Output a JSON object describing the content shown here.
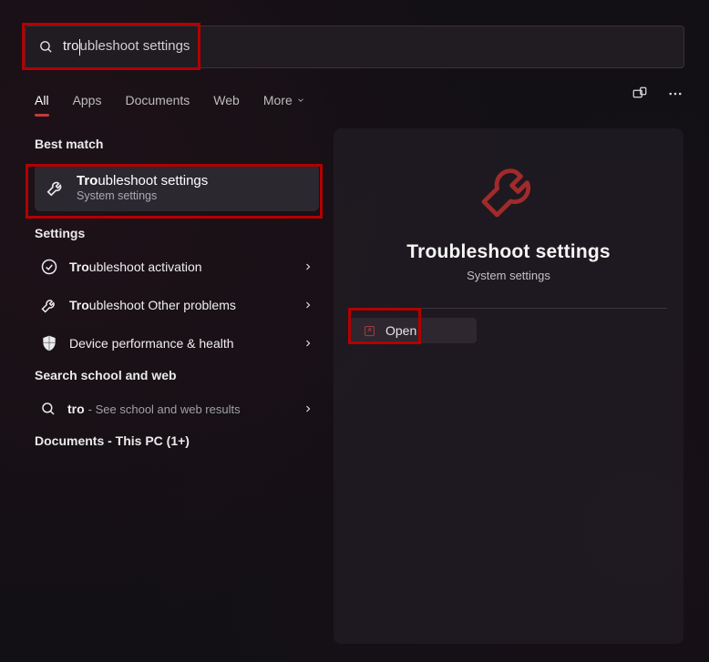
{
  "search": {
    "typed": "tro",
    "completion": "ubleshoot settings"
  },
  "filters": {
    "tabs": [
      "All",
      "Apps",
      "Documents",
      "Web",
      "More"
    ],
    "active_index": 0
  },
  "sections": {
    "best_match_head": "Best match",
    "best_match": {
      "title_bold": "Tro",
      "title_rest": "ubleshoot settings",
      "subtitle": "System settings"
    },
    "settings_head": "Settings",
    "settings_items": [
      {
        "bold": "Tro",
        "rest": "ubleshoot activation",
        "icon": "check"
      },
      {
        "bold": "Tro",
        "rest": "ubleshoot Other problems",
        "icon": "wrench"
      },
      {
        "bold": "",
        "rest": "Device performance & health",
        "icon": "shield"
      }
    ],
    "school_head": "Search school and web",
    "school_item": {
      "bold": "tro",
      "sub": " - See school and web results",
      "icon": "search"
    },
    "docs_head": "Documents - This PC (1+)"
  },
  "preview": {
    "title": "Troubleshoot settings",
    "subtitle": "System settings",
    "open_label": "Open"
  }
}
